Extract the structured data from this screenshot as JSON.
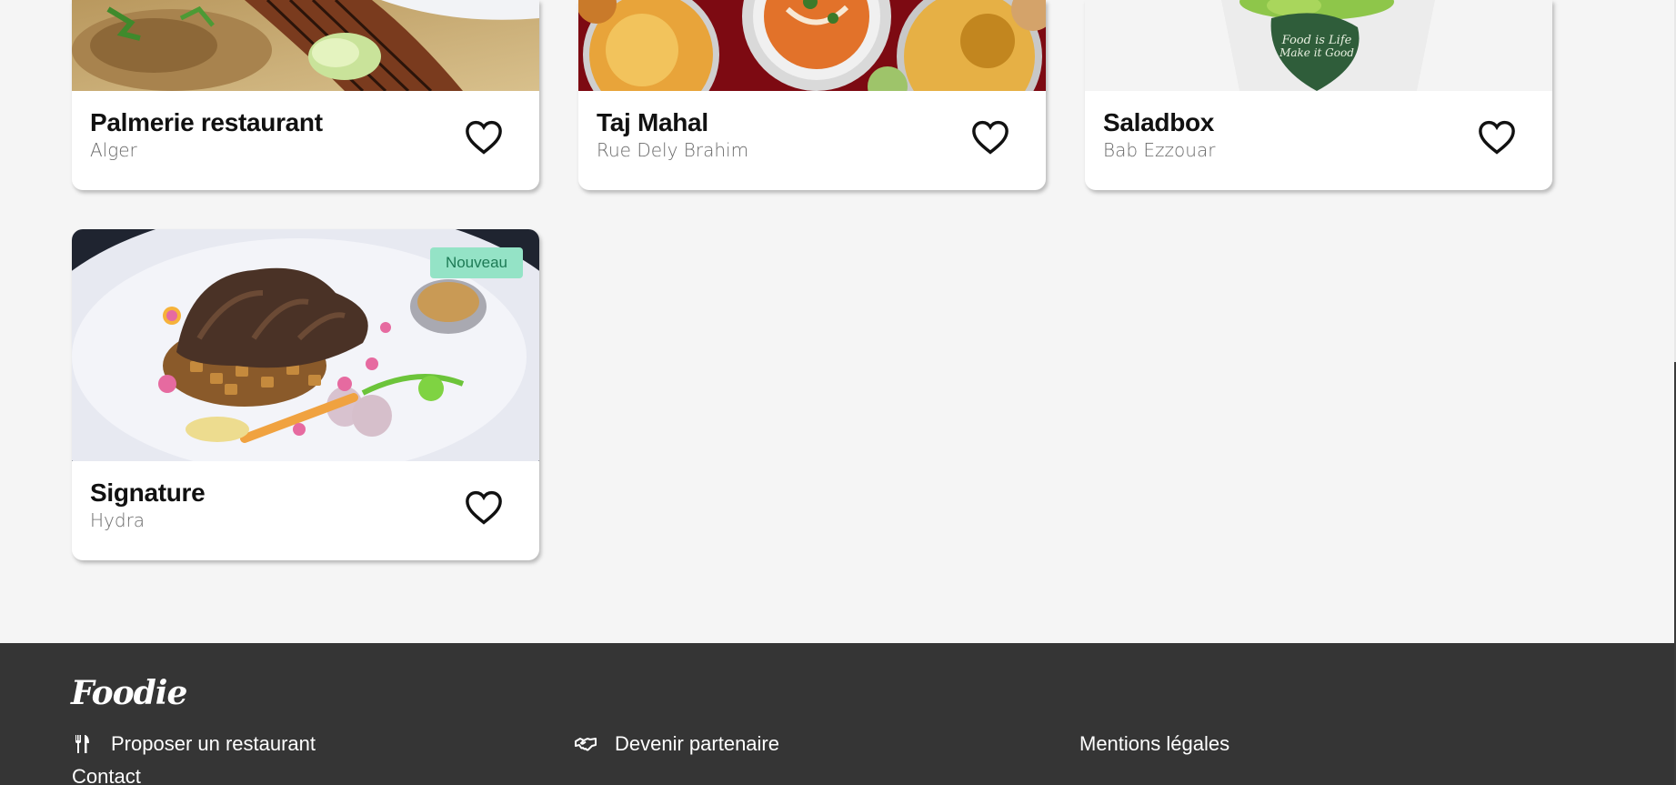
{
  "restaurants": [
    {
      "name": "Palmerie restaurant",
      "location": "Alger"
    },
    {
      "name": "Taj Mahal",
      "location": "Rue Dely Brahim"
    },
    {
      "name": "Saladbox",
      "location": "Bab Ezzouar"
    },
    {
      "name": "Signature",
      "location": "Hydra",
      "badge": "Nouveau"
    }
  ],
  "footer": {
    "logo": "Foodie",
    "links": {
      "propose": "Proposer un restaurant",
      "partner": "Devenir partenaire",
      "legal": "Mentions légales",
      "contact": "Contact"
    },
    "background": "#353535"
  },
  "icons": {
    "favorite": "heart-outline-icon",
    "propose": "fork-knife-icon",
    "partner": "handshake-icon"
  },
  "colors": {
    "page_bg": "#f5f5f5",
    "badge_bg": "#94e3c6",
    "badge_text": "#1d7a55"
  }
}
